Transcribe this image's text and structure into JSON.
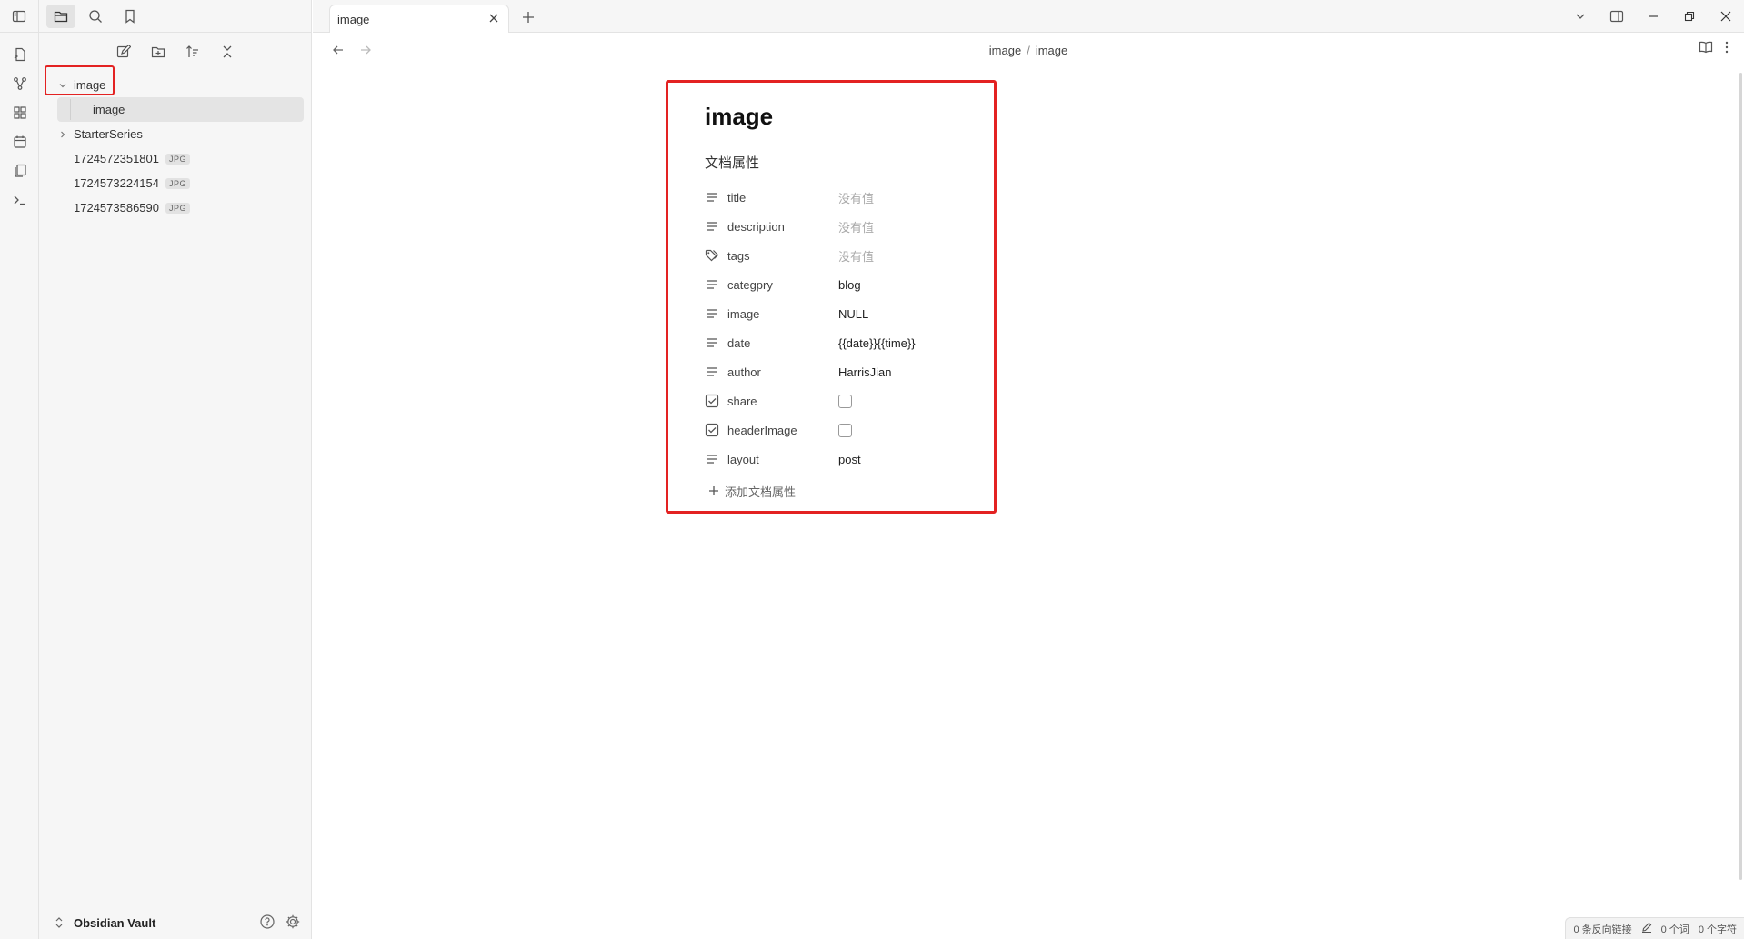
{
  "sidebar": {
    "tree": {
      "folder": {
        "label": "image",
        "expanded": true
      },
      "folder_child": {
        "label": "image"
      },
      "subfolder": {
        "label": "StarterSeries",
        "expanded": false
      },
      "files": [
        {
          "label": "1724572351801",
          "tag": "JPG"
        },
        {
          "label": "1724573224154",
          "tag": "JPG"
        },
        {
          "label": "1724573586590",
          "tag": "JPG"
        }
      ]
    },
    "vault_name": "Obsidian Vault"
  },
  "tabbar": {
    "active_tab": "image"
  },
  "breadcrumb": {
    "parts": [
      "image",
      "image"
    ],
    "separator": "/"
  },
  "document": {
    "title": "image",
    "properties_heading": "文档属性",
    "properties": [
      {
        "icon": "text-lines-icon",
        "key": "title",
        "value": "没有值",
        "empty": true
      },
      {
        "icon": "text-lines-icon",
        "key": "description",
        "value": "没有值",
        "empty": true
      },
      {
        "icon": "tags-icon",
        "key": "tags",
        "value": "没有值",
        "empty": true
      },
      {
        "icon": "text-lines-icon",
        "key": "categpry",
        "value": "blog"
      },
      {
        "icon": "text-lines-icon",
        "key": "image",
        "value": "NULL"
      },
      {
        "icon": "text-lines-icon",
        "key": "date",
        "value": "{{date}}{{time}}"
      },
      {
        "icon": "text-lines-icon",
        "key": "author",
        "value": "HarrisJian"
      },
      {
        "icon": "checkbox-icon",
        "key": "share",
        "value": false
      },
      {
        "icon": "checkbox-icon",
        "key": "headerImage",
        "value": false
      },
      {
        "icon": "text-lines-icon",
        "key": "layout",
        "value": "post"
      }
    ],
    "add_property_label": "添加文档属性"
  },
  "statusbar": {
    "backlinks": "0 条反向链接",
    "words": "0 个词",
    "chars": "0 个字符"
  },
  "colors": {
    "highlight_box": "#e32222",
    "sidebar_bg": "#f6f6f6",
    "selected_item_bg": "#e4e4e4"
  }
}
